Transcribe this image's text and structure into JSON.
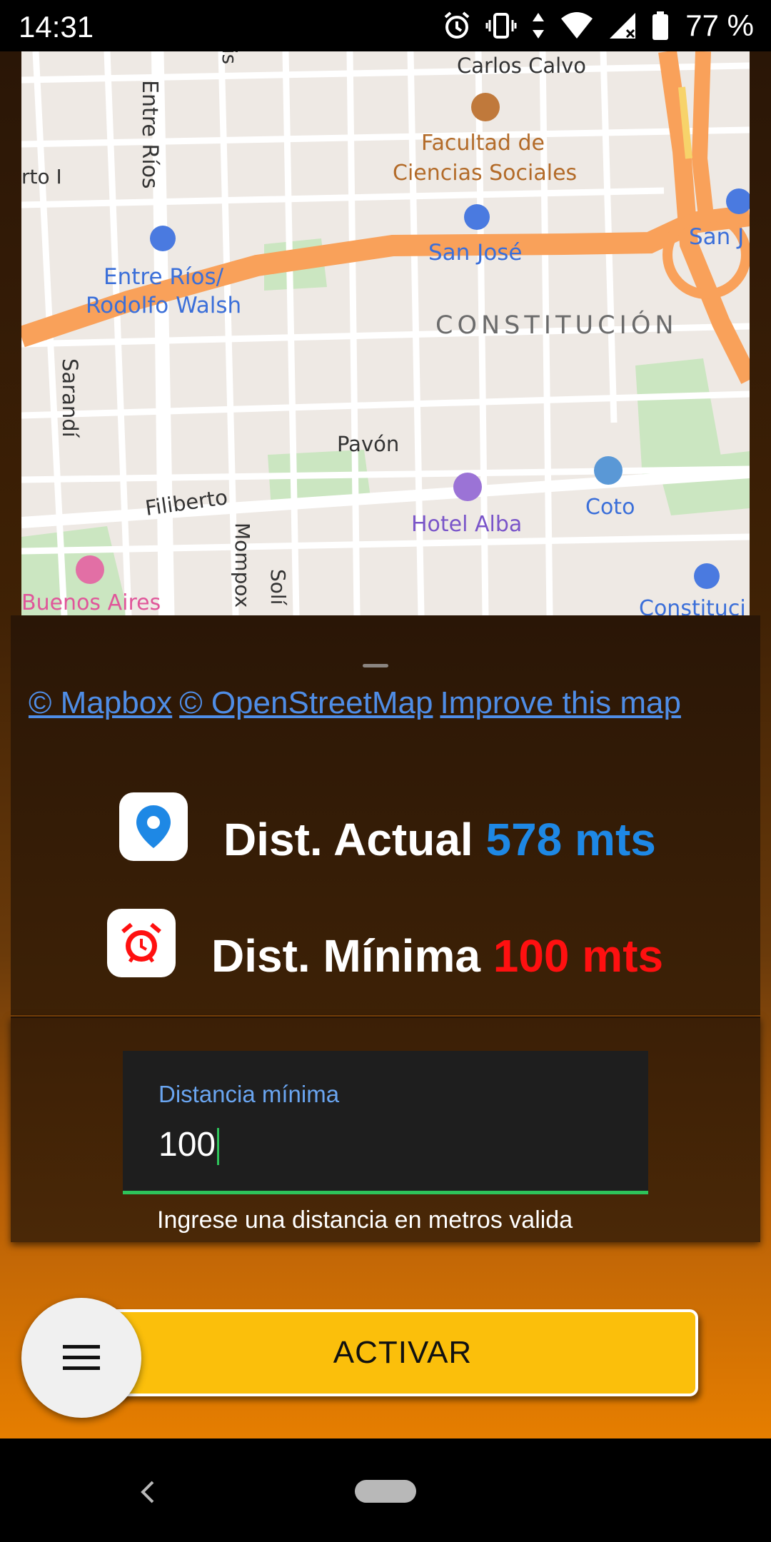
{
  "status_bar": {
    "time": "14:31",
    "battery": "77 %",
    "icons": [
      "alarm-icon",
      "vibrate-icon",
      "data-arrows-icon",
      "wifi-icon",
      "signal-icon",
      "battery-icon"
    ]
  },
  "map": {
    "labels": {
      "carlos_calvo": "Carlos Calvo",
      "facultad_1": "Facultad de",
      "facultad_2": "Ciencias Sociales",
      "entre_rios_street": "Entre Ríos",
      "luis": "uis",
      "perito": "rto I",
      "station_entre_rios_1": "Entre Ríos/",
      "station_entre_rios_2": "Rodolfo Walsh",
      "san_jose": "San José",
      "san_j_edge": "San J",
      "constitucion": "CONSTITUCIÓN",
      "sarandi": "Sarandí",
      "pavon": "Pavón",
      "filiberto": "Filiberto",
      "hotel": "Hotel Alba",
      "coto": "Coto",
      "mompox": "Mompox",
      "solis": "Solí",
      "buenos_aires": "Buenos Aires",
      "constitucion_edge": "Constituci"
    },
    "colors": {
      "land": "#eee9e4",
      "street": "#ffffff",
      "highway": "#f9a15a",
      "park": "#cbe6c1",
      "poi_text_blue": "#3b6fd9"
    }
  },
  "attribution": {
    "mapbox": "© Mapbox",
    "osm": "© OpenStreetMap",
    "improve": "Improve this map"
  },
  "distance": {
    "current_label": "Dist. Actual",
    "current_value": "578 mts",
    "minimum_label": "Dist. Mínima",
    "minimum_value": "100 mts"
  },
  "form": {
    "field_label": "Distancia mínima",
    "field_value": "100",
    "helper_text": "Ingrese una distancia en metros valida"
  },
  "actions": {
    "activate_label": "ACTIVAR"
  },
  "colors": {
    "accent_blue": "#1e88e5",
    "accent_red": "#ff1010",
    "button_yellow": "#fbbf0b",
    "focus_green": "#2ec35a"
  }
}
